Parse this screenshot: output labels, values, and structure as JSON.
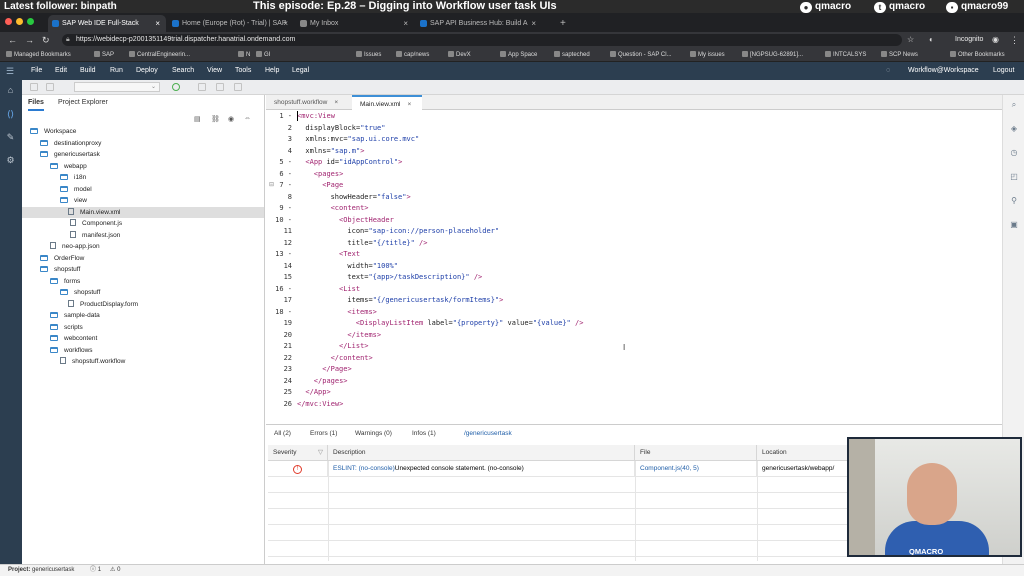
{
  "stream": {
    "follower": "Latest follower: binpath",
    "episode": "This episode: Ep.28 – Digging into Workflow user task UIs",
    "github": "qmacro",
    "twitter": "qmacro",
    "twitch": "qmacro99"
  },
  "browser": {
    "tabs": [
      {
        "label": "SAP Web IDE Full-Stack",
        "color": "#1b72c9"
      },
      {
        "label": "Home (Europe (Rot) - Trial) | SAP",
        "color": "#1b72c9"
      },
      {
        "label": "My Inbox",
        "color": "#888888"
      },
      {
        "label": "SAP API Business Hub: Build A",
        "color": "#1b72c9"
      }
    ],
    "new_tab": "+",
    "url": "https://webidecp-p2001351149trial.dispatcher.hanatrial.ondemand.com",
    "profile": "Incognito",
    "bookmarks": [
      "Managed Bookmarks",
      "SAP",
      "CentralEngineerin...",
      "N",
      "GI",
      "Issues",
      "cap/news",
      "DevX",
      "App Space",
      "sapteched",
      "Question - SAP Cl...",
      "My issues",
      "[NGPSUG-62891]...",
      "INTCALSYS",
      "SCP News",
      "Other Bookmarks"
    ]
  },
  "ide": {
    "menu": [
      "File",
      "Edit",
      "Build",
      "Run",
      "Deploy",
      "Search",
      "View",
      "Tools",
      "Help",
      "Legal"
    ],
    "workspace_label": "Workflow@Workspace",
    "logout": "Logout"
  },
  "explorer": {
    "tabs": [
      "Files",
      "Project Explorer"
    ],
    "tree": [
      {
        "label": "Workspace",
        "type": "folder",
        "depth": 0
      },
      {
        "label": "destinationproxy",
        "type": "folder",
        "depth": 1
      },
      {
        "label": "genericusertask",
        "type": "folder",
        "depth": 1
      },
      {
        "label": "webapp",
        "type": "folder",
        "depth": 2
      },
      {
        "label": "i18n",
        "type": "folder",
        "depth": 3
      },
      {
        "label": "model",
        "type": "folder",
        "depth": 3
      },
      {
        "label": "view",
        "type": "folder",
        "depth": 3
      },
      {
        "label": "Main.view.xml",
        "type": "file",
        "depth": 4,
        "selected": true
      },
      {
        "label": "Component.js",
        "type": "file",
        "depth": 3
      },
      {
        "label": "manifest.json",
        "type": "file",
        "depth": 3
      },
      {
        "label": "neo-app.json",
        "type": "file",
        "depth": 2
      },
      {
        "label": "OrderFlow",
        "type": "folder",
        "depth": 1
      },
      {
        "label": "shopstuff",
        "type": "folder",
        "depth": 1
      },
      {
        "label": "forms",
        "type": "folder",
        "depth": 2
      },
      {
        "label": "shopstuff",
        "type": "folder",
        "depth": 3
      },
      {
        "label": "ProductDisplay.form",
        "type": "file",
        "depth": 4
      },
      {
        "label": "sample-data",
        "type": "folder",
        "depth": 2
      },
      {
        "label": "scripts",
        "type": "folder",
        "depth": 2
      },
      {
        "label": "webcontent",
        "type": "folder",
        "depth": 2
      },
      {
        "label": "workflows",
        "type": "folder",
        "depth": 2
      },
      {
        "label": "shopstuff.workflow",
        "type": "file",
        "depth": 3
      }
    ]
  },
  "editor": {
    "tabs": [
      {
        "label": "shopstuff.workflow",
        "active": false
      },
      {
        "label": "Main.view.xml",
        "active": true
      }
    ],
    "close_glyph": "×",
    "lines": [
      {
        "n": "1 -",
        "indent": 0,
        "parts": [
          [
            "tg",
            "<mvc:View"
          ]
        ]
      },
      {
        "n": "2",
        "indent": 2,
        "parts": [
          [
            "at",
            "displayBlock="
          ],
          [
            "st",
            "\"true\""
          ]
        ]
      },
      {
        "n": "3",
        "indent": 2,
        "parts": [
          [
            "at",
            "xmlns:mvc="
          ],
          [
            "st",
            "\"sap.ui.core.mvc\""
          ]
        ]
      },
      {
        "n": "4",
        "indent": 2,
        "parts": [
          [
            "at",
            "xmlns="
          ],
          [
            "st",
            "\"sap.m\""
          ],
          [
            "tg",
            ">"
          ]
        ]
      },
      {
        "n": "5 -",
        "indent": 2,
        "parts": [
          [
            "tg",
            "<App "
          ],
          [
            "at",
            "id="
          ],
          [
            "st",
            "\"idAppControl\""
          ],
          [
            "tg",
            ">"
          ]
        ]
      },
      {
        "n": "6 -",
        "indent": 4,
        "parts": [
          [
            "tg",
            "<pages>"
          ]
        ]
      },
      {
        "n": "7 -",
        "indent": 6,
        "parts": [
          [
            "tg",
            "<Page"
          ]
        ]
      },
      {
        "n": "8",
        "indent": 8,
        "parts": [
          [
            "at",
            "showHeader="
          ],
          [
            "st",
            "\"false\""
          ],
          [
            "tg",
            ">"
          ]
        ]
      },
      {
        "n": "9 -",
        "indent": 8,
        "parts": [
          [
            "tg",
            "<content>"
          ]
        ]
      },
      {
        "n": "10 -",
        "indent": 10,
        "parts": [
          [
            "tg",
            "<ObjectHeader"
          ]
        ]
      },
      {
        "n": "11",
        "indent": 12,
        "parts": [
          [
            "at",
            "icon="
          ],
          [
            "st",
            "\"sap-icon://person-placeholder\""
          ]
        ]
      },
      {
        "n": "12",
        "indent": 12,
        "parts": [
          [
            "at",
            "title="
          ],
          [
            "st",
            "\"{/title}\""
          ],
          [
            "tg",
            " />"
          ]
        ]
      },
      {
        "n": "13 -",
        "indent": 10,
        "parts": [
          [
            "tg",
            "<Text"
          ]
        ]
      },
      {
        "n": "14",
        "indent": 12,
        "parts": [
          [
            "at",
            "width="
          ],
          [
            "st",
            "\"100%\""
          ]
        ]
      },
      {
        "n": "15",
        "indent": 12,
        "parts": [
          [
            "at",
            "text="
          ],
          [
            "st",
            "\"{app>/taskDescription}\""
          ],
          [
            "tg",
            " />"
          ]
        ]
      },
      {
        "n": "16 -",
        "indent": 10,
        "parts": [
          [
            "tg",
            "<List"
          ]
        ]
      },
      {
        "n": "17",
        "indent": 12,
        "parts": [
          [
            "at",
            "items="
          ],
          [
            "st",
            "\"{/genericusertask/formItems}\""
          ],
          [
            "tg",
            ">"
          ]
        ]
      },
      {
        "n": "18 -",
        "indent": 12,
        "parts": [
          [
            "tg",
            "<items>"
          ]
        ]
      },
      {
        "n": "19",
        "indent": 14,
        "parts": [
          [
            "tg",
            "<DisplayListItem "
          ],
          [
            "at",
            "label="
          ],
          [
            "st",
            "\"{property}\""
          ],
          [
            "at",
            " value="
          ],
          [
            "st",
            "\"{value}\""
          ],
          [
            "tg",
            " />"
          ]
        ]
      },
      {
        "n": "20",
        "indent": 12,
        "parts": [
          [
            "tg",
            "</items>"
          ]
        ]
      },
      {
        "n": "21",
        "indent": 10,
        "parts": [
          [
            "tg",
            "</List>"
          ]
        ]
      },
      {
        "n": "22",
        "indent": 8,
        "parts": [
          [
            "tg",
            "</content>"
          ]
        ]
      },
      {
        "n": "23",
        "indent": 6,
        "parts": [
          [
            "tg",
            "</Page>"
          ]
        ]
      },
      {
        "n": "24",
        "indent": 4,
        "parts": [
          [
            "tg",
            "</pages>"
          ]
        ]
      },
      {
        "n": "25",
        "indent": 2,
        "parts": [
          [
            "tg",
            "</App>"
          ]
        ]
      },
      {
        "n": "26",
        "indent": 0,
        "parts": [
          [
            "tg",
            "</mvc:View>"
          ]
        ]
      }
    ]
  },
  "problems": {
    "tabs": [
      "All (2)",
      "Errors (1)",
      "Warnings (0)",
      "Infos (1)",
      "/genericusertask"
    ],
    "columns": [
      "Severity",
      "Description",
      "File",
      "Location"
    ],
    "rows": [
      {
        "severity_icon": "!",
        "rule": "ESLINT: (no-console)",
        "message": "Unexpected console statement. (no-console)",
        "file": "Component.js(40, 5)",
        "location": "genericusertask/webapp/"
      }
    ]
  },
  "webcam": {
    "label": "QMACRO"
  },
  "statusbar": {
    "project_label": "Project:",
    "project_name": "genericusertask",
    "errors": "1",
    "warnings": "0"
  },
  "colors": {
    "ide_header": "#2c3e50",
    "accent": "#2b7bd1",
    "tag": "#a0236f",
    "string": "#1d3ea8",
    "error": "#e03a2a"
  }
}
